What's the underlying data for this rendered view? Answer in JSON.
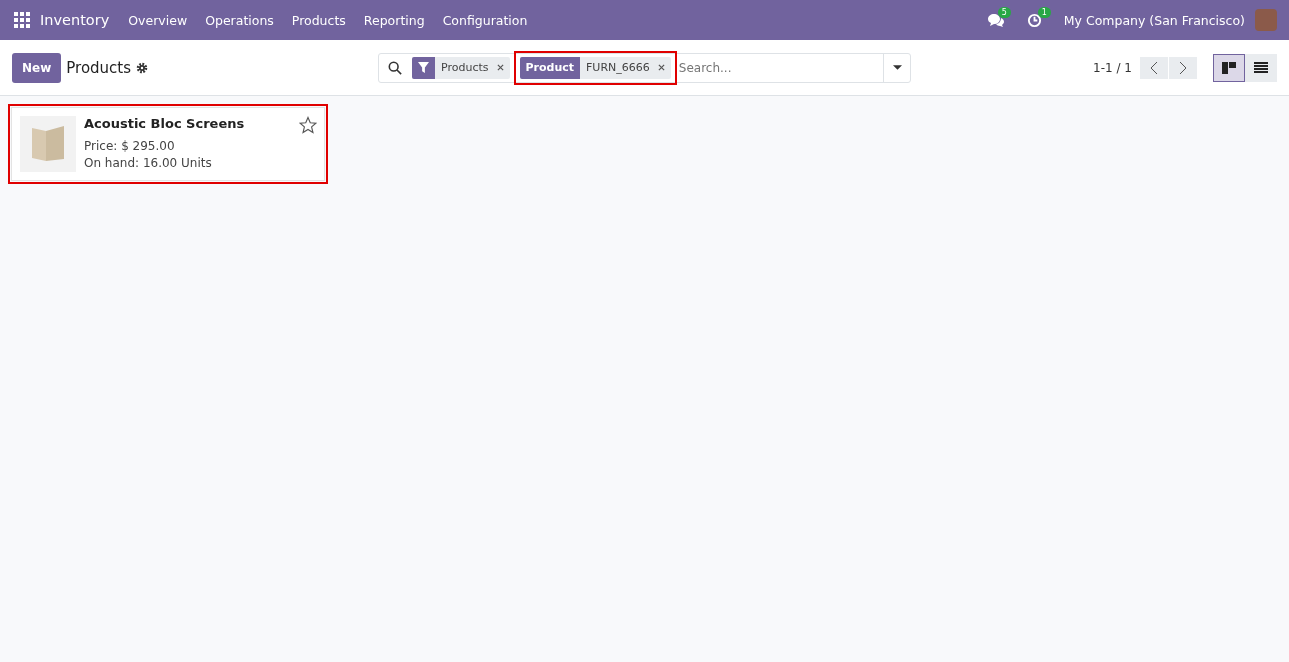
{
  "navbar": {
    "app": "Inventory",
    "menu": [
      "Overview",
      "Operations",
      "Products",
      "Reporting",
      "Configuration"
    ],
    "messages_count": "5",
    "activities_count": "1",
    "company": "My Company (San Francisco)"
  },
  "control_panel": {
    "new_button": "New",
    "title": "Products",
    "pager": "1-1 / 1",
    "views": [
      {
        "kind": "kanban",
        "selected": true
      },
      {
        "kind": "list",
        "selected": false
      }
    ]
  },
  "search": {
    "facets": [
      {
        "kind": "filter",
        "label": "Products",
        "highlighted": false
      },
      {
        "kind": "field",
        "field": "Product",
        "label": "FURN_6666",
        "highlighted": true
      }
    ],
    "placeholder": "Search..."
  },
  "cards": [
    {
      "name": "Acoustic Bloc Screens",
      "price": "Price: $ 295.00",
      "on_hand": "On hand: 16.00 Units",
      "starred": false,
      "highlighted": true
    }
  ]
}
